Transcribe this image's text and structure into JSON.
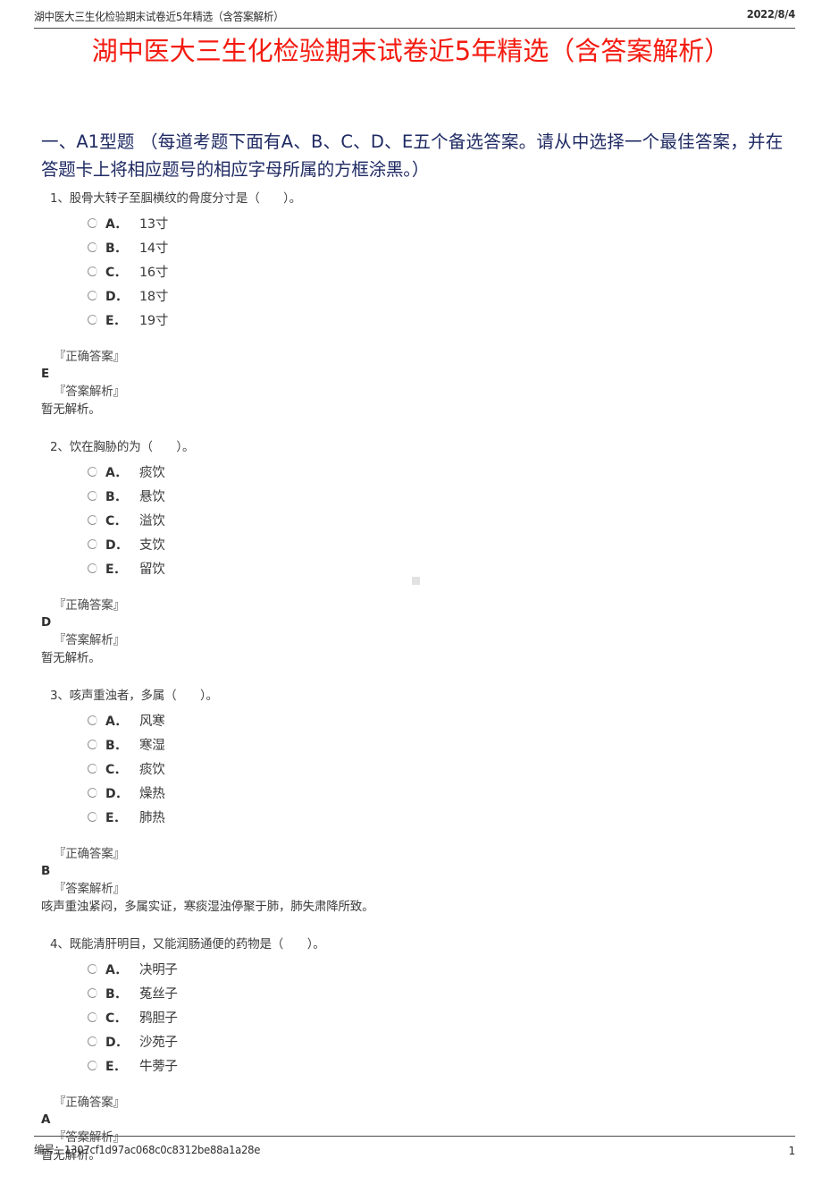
{
  "header": {
    "left_title": "湖中医大三生化检验期末试卷近5年精选（含答案解析）",
    "date": "2022/8/4"
  },
  "title": "湖中医大三生化检验期末试卷近5年精选（含答案解析）",
  "title_color": "#f41b10",
  "section": {
    "heading": "一、A1型题 （每道考题下面有A、B、C、D、E五个备选答案。请从中选择一个最佳答案，并在答题卡上将相应题号的相应字母所属的方框涂黑。）",
    "heading_color": "#1f2a63"
  },
  "labels": {
    "correct_answer": "『正确答案』",
    "answer_explanation": "『答案解析』"
  },
  "questions": [
    {
      "stem": "1、股骨大转子至腘横纹的骨度分寸是（　　）。",
      "options": [
        {
          "letter": "A．",
          "text": "13寸"
        },
        {
          "letter": "B．",
          "text": "14寸"
        },
        {
          "letter": "C．",
          "text": "16寸"
        },
        {
          "letter": "D．",
          "text": "18寸"
        },
        {
          "letter": "E．",
          "text": "19寸"
        }
      ],
      "answer": "E",
      "explanation": "暂无解析。"
    },
    {
      "stem": "2、饮在胸胁的为（　　）。",
      "options": [
        {
          "letter": "A．",
          "text": "痰饮"
        },
        {
          "letter": "B．",
          "text": "悬饮"
        },
        {
          "letter": "C．",
          "text": "溢饮"
        },
        {
          "letter": "D．",
          "text": "支饮"
        },
        {
          "letter": "E．",
          "text": "留饮"
        }
      ],
      "answer": "D",
      "explanation": "暂无解析。"
    },
    {
      "stem": "3、咳声重浊者，多属（　　）。",
      "options": [
        {
          "letter": "A．",
          "text": "风寒"
        },
        {
          "letter": "B．",
          "text": "寒湿"
        },
        {
          "letter": "C．",
          "text": "痰饮"
        },
        {
          "letter": "D．",
          "text": "燥热"
        },
        {
          "letter": "E．",
          "text": "肺热"
        }
      ],
      "answer": "B",
      "explanation": "咳声重浊紧闷，多属实证，寒痰湿浊停聚于肺，肺失肃降所致。"
    },
    {
      "stem": "4、既能清肝明目，又能润肠通便的药物是（　　）。",
      "options": [
        {
          "letter": "A．",
          "text": "决明子"
        },
        {
          "letter": "B．",
          "text": "菟丝子"
        },
        {
          "letter": "C．",
          "text": "鸦胆子"
        },
        {
          "letter": "D．",
          "text": "沙苑子"
        },
        {
          "letter": "E．",
          "text": "牛蒡子"
        }
      ],
      "answer": "A",
      "explanation": "暂无解析。"
    }
  ],
  "footer": {
    "serial_label": "编号：1307cf1d97ac068c0c8312be88a1a28e",
    "page_number": "1"
  }
}
